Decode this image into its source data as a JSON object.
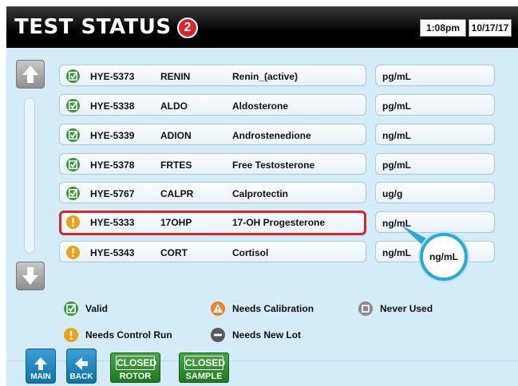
{
  "header": {
    "title": "TEST STATUS",
    "badge_count": "2",
    "time": "1:08pm",
    "date": "10/17/17"
  },
  "tests": [
    {
      "status": "valid",
      "code": "HYE-5373",
      "abbr": "RENIN",
      "name": "Renin_(active)",
      "unit": "pg/mL"
    },
    {
      "status": "valid",
      "code": "HYE-5338",
      "abbr": "ALDO",
      "name": "Aldosterone",
      "unit": "pg/mL"
    },
    {
      "status": "valid",
      "code": "HYE-5339",
      "abbr": "ADION",
      "name": "Androstenedione",
      "unit": "ng/mL"
    },
    {
      "status": "valid",
      "code": "HYE-5378",
      "abbr": "FRTES",
      "name": "Free Testosterone",
      "unit": "pg/mL"
    },
    {
      "status": "valid",
      "code": "HYE-5767",
      "abbr": "CALPR",
      "name": "Calprotectin",
      "unit": "ug/g"
    },
    {
      "status": "needs-control-run",
      "code": "HYE-5333",
      "abbr": "17OHP",
      "name": "17-OH Progesterone",
      "unit": "ng/mL"
    },
    {
      "status": "needs-control-run",
      "code": "HYE-5343",
      "abbr": "CORT",
      "name": "Cortisol",
      "unit": "ng/mL"
    }
  ],
  "magnifier": {
    "text": "ng/mL"
  },
  "legend": {
    "valid": "Valid",
    "needs_calibration": "Needs Calibration",
    "never_used": "Never Used",
    "needs_control_run": "Needs Control Run",
    "needs_new_lot": "Needs New Lot"
  },
  "footer": {
    "main_label": "MAIN",
    "back_label": "BACK",
    "rotor": {
      "top": "CLOSED",
      "bottom": "ROTOR"
    },
    "sample": {
      "top": "CLOSED",
      "bottom": "SAMPLE"
    }
  },
  "colors": {
    "valid": "#3a9a3a",
    "warning": "#e8a317",
    "calibration": "#e8842c",
    "selected": "#d8272b",
    "accent": "#2aa8d8"
  },
  "icons": {
    "valid": "checkbox-check-icon",
    "needs_control_run": "exclamation-circle-icon",
    "needs_calibration": "warning-triangle-icon",
    "never_used": "empty-square-icon",
    "needs_new_lot": "minus-circle-icon"
  }
}
